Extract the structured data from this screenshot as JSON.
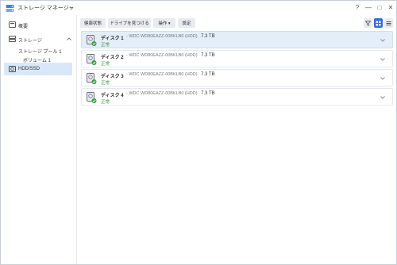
{
  "window": {
    "title": "ストレージ マネージャ",
    "controls": {
      "help": "?",
      "minimize": "—",
      "maximize": "□",
      "close": "✕"
    }
  },
  "sidebar": {
    "overview_label": "概要",
    "storage_label": "ストレージ",
    "pool_label": "ストレージ プール 1",
    "volume_label": "ボリューム 1",
    "hdd_label": "HDD/SSD"
  },
  "toolbar": {
    "health_label": "健康状態",
    "find_drive_label": "ドライブを見つける",
    "action_label": "操作 ▾",
    "settings_label": "設定",
    "icons": [
      "filter-icon",
      "grid-view-icon",
      "list-view-icon"
    ]
  },
  "disks": [
    {
      "name": "ディスク 1",
      "model": "- WDC WD80EAZZ-00BKLB0 (HDD)",
      "size": "7.3 TB",
      "status": "正常"
    },
    {
      "name": "ディスク 2",
      "model": "- WDC WD80EAZZ-00BKLB0 (HDD)",
      "size": "7.3 TB",
      "status": "正常"
    },
    {
      "name": "ディスク 3",
      "model": "- WDC WD80EAZZ-00BKLB0 (HDD)",
      "size": "7.3 TB",
      "status": "正常"
    },
    {
      "name": "ディスク 4",
      "model": "- WDC WD80EAZZ-00BKLB0 (HDD)",
      "size": "7.3 TB",
      "status": "正常"
    }
  ],
  "colors": {
    "accent": "#2f6fd8",
    "selected_row": "#e3eef9",
    "status_ok": "#2e9e3e"
  }
}
